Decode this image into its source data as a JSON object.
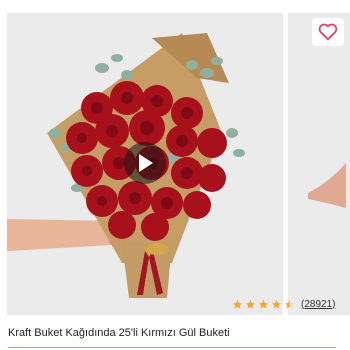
{
  "product": {
    "title": "Kraft Buket Kağıdında 25'li Kırmızı Gül Buketi",
    "image_alt": "Kraft paper bouquet of red roses with eucalyptus",
    "rating": {
      "stars": 4.5,
      "count": "(28921)"
    }
  },
  "icons": {
    "favorite": "heart-icon",
    "video": "play-icon",
    "rating": "star-icon"
  },
  "colors": {
    "accent": "#e8365d",
    "star": "#f5a623",
    "star_empty": "#d8d8d8",
    "underline": "#86c06a"
  }
}
